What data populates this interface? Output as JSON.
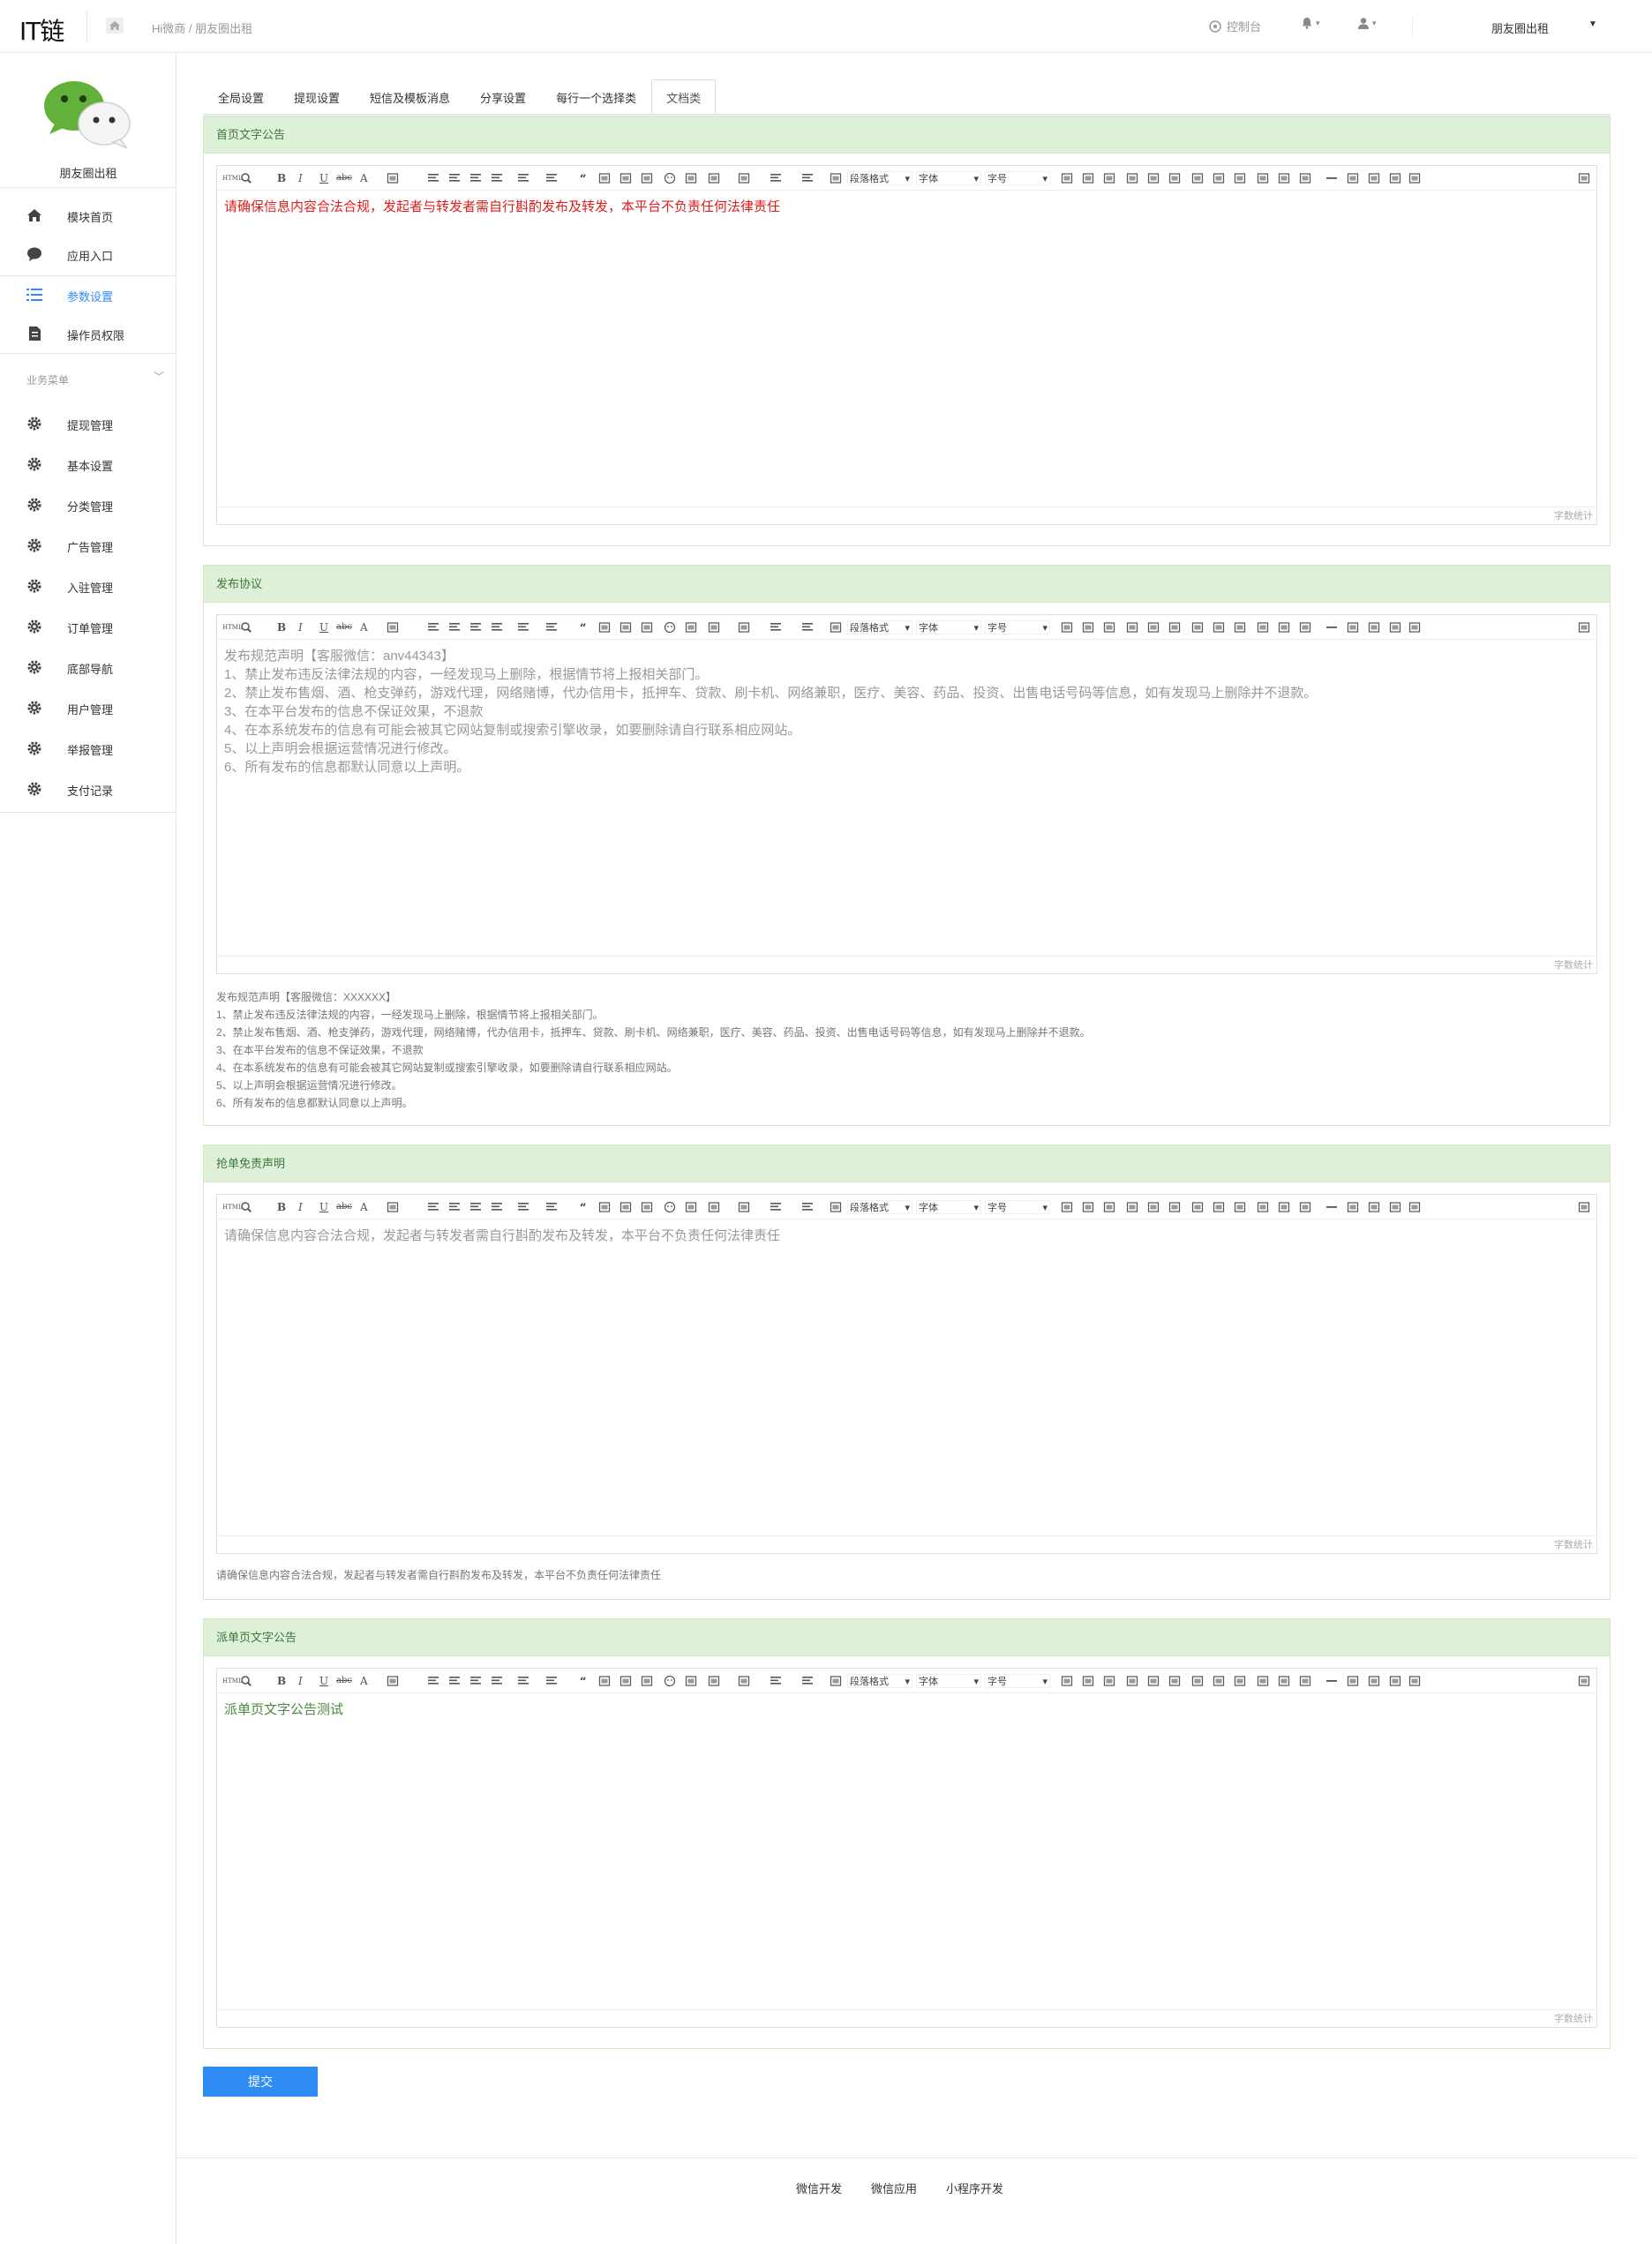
{
  "header": {
    "logo": "IT链",
    "breadcrumb": "Hi微商 / 朋友圈出租",
    "console": "控制台",
    "user_name": "朋友圈出租"
  },
  "sidebar": {
    "account_name": "朋友圈出租",
    "items": [
      {
        "label": "模块首页",
        "icon": "home-icon"
      },
      {
        "label": "应用入口",
        "icon": "chat-icon"
      },
      {
        "label": "参数设置",
        "icon": "list-icon",
        "active": true
      },
      {
        "label": "操作员权限",
        "icon": "doc-icon"
      }
    ],
    "group_label": "业务菜单",
    "group_items": [
      {
        "label": "提现管理",
        "icon": "gear-icon"
      },
      {
        "label": "基本设置",
        "icon": "gear-icon"
      },
      {
        "label": "分类管理",
        "icon": "gear-icon"
      },
      {
        "label": "广告管理",
        "icon": "gear-icon"
      },
      {
        "label": "入驻管理",
        "icon": "gear-icon"
      },
      {
        "label": "订单管理",
        "icon": "gear-icon"
      },
      {
        "label": "底部导航",
        "icon": "gear-icon"
      },
      {
        "label": "用户管理",
        "icon": "gear-icon"
      },
      {
        "label": "举报管理",
        "icon": "gear-icon"
      },
      {
        "label": "支付记录",
        "icon": "gear-icon"
      }
    ]
  },
  "tabs": [
    {
      "label": "全局设置"
    },
    {
      "label": "提现设置"
    },
    {
      "label": "短信及模板消息"
    },
    {
      "label": "分享设置"
    },
    {
      "label": "每行一个选择类"
    },
    {
      "label": "文档类",
      "active": true
    }
  ],
  "editor_toolbar": {
    "html": "HTML",
    "bold": "B",
    "italic": "I",
    "underline": "U",
    "strike": "abc",
    "fontcolor": "A",
    "paragraph": "段落格式",
    "font": "字体",
    "fontsize": "字号",
    "wordcount": "字数统计"
  },
  "panels": [
    {
      "title": "首页文字公告",
      "content": [
        "请确保信息内容合法合规，发起者与转发者需自行斟酌发布及转发，本平台不负责任何法律责任"
      ]
    },
    {
      "title": "发布协议",
      "content": [
        "发布规范声明【客服微信：anv44343】",
        "1、禁止发布违反法律法规的内容，一经发现马上删除，根据情节将上报相关部门。",
        "2、禁止发布售烟、酒、枪支弹药，游戏代理，网络赌博，代办信用卡，抵押车、贷款、刷卡机、网络兼职，医疗、美容、药品、投资、出售电话号码等信息，如有发现马上删除并不退款。",
        "3、在本平台发布的信息不保证效果，不退款",
        "4、在本系统发布的信息有可能会被其它网站复制或搜索引擎收录，如要删除请自行联系相应网站。",
        "5、以上声明会根据运营情况进行修改。",
        "6、所有发布的信息都默认同意以上声明。"
      ],
      "help": [
        "发布规范声明【客服微信：XXXXXX】",
        "1、禁止发布违反法律法规的内容，一经发现马上删除，根据情节将上报相关部门。",
        "2、禁止发布售烟、酒、枪支弹药，游戏代理，网络赌博，代办信用卡，抵押车、贷款、刷卡机、网络兼职，医疗、美容、药品、投资、出售电话号码等信息，如有发现马上删除并不退款。",
        "3、在本平台发布的信息不保证效果，不退款",
        "4、在本系统发布的信息有可能会被其它网站复制或搜索引擎收录，如要删除请自行联系相应网站。",
        "5、以上声明会根据运营情况进行修改。",
        "6、所有发布的信息都默认同意以上声明。"
      ]
    },
    {
      "title": "抢单免责声明",
      "content": [
        "请确保信息内容合法合规，发起者与转发者需自行斟酌发布及转发，本平台不负责任何法律责任"
      ],
      "help": [
        "请确保信息内容合法合规，发起者与转发者需自行斟酌发布及转发，本平台不负责任何法律责任"
      ]
    },
    {
      "title": "派单页文字公告",
      "content": [
        "派单页文字公告测试"
      ]
    }
  ],
  "submit_label": "提交",
  "footer": {
    "links": [
      "微信开发",
      "微信应用",
      "小程序开发"
    ]
  },
  "colors": {
    "accent": "#2f8cf5",
    "panel_head_bg": "#dff0d8",
    "panel_head_text": "#3c763d",
    "warning_text": "#e01e1e"
  }
}
